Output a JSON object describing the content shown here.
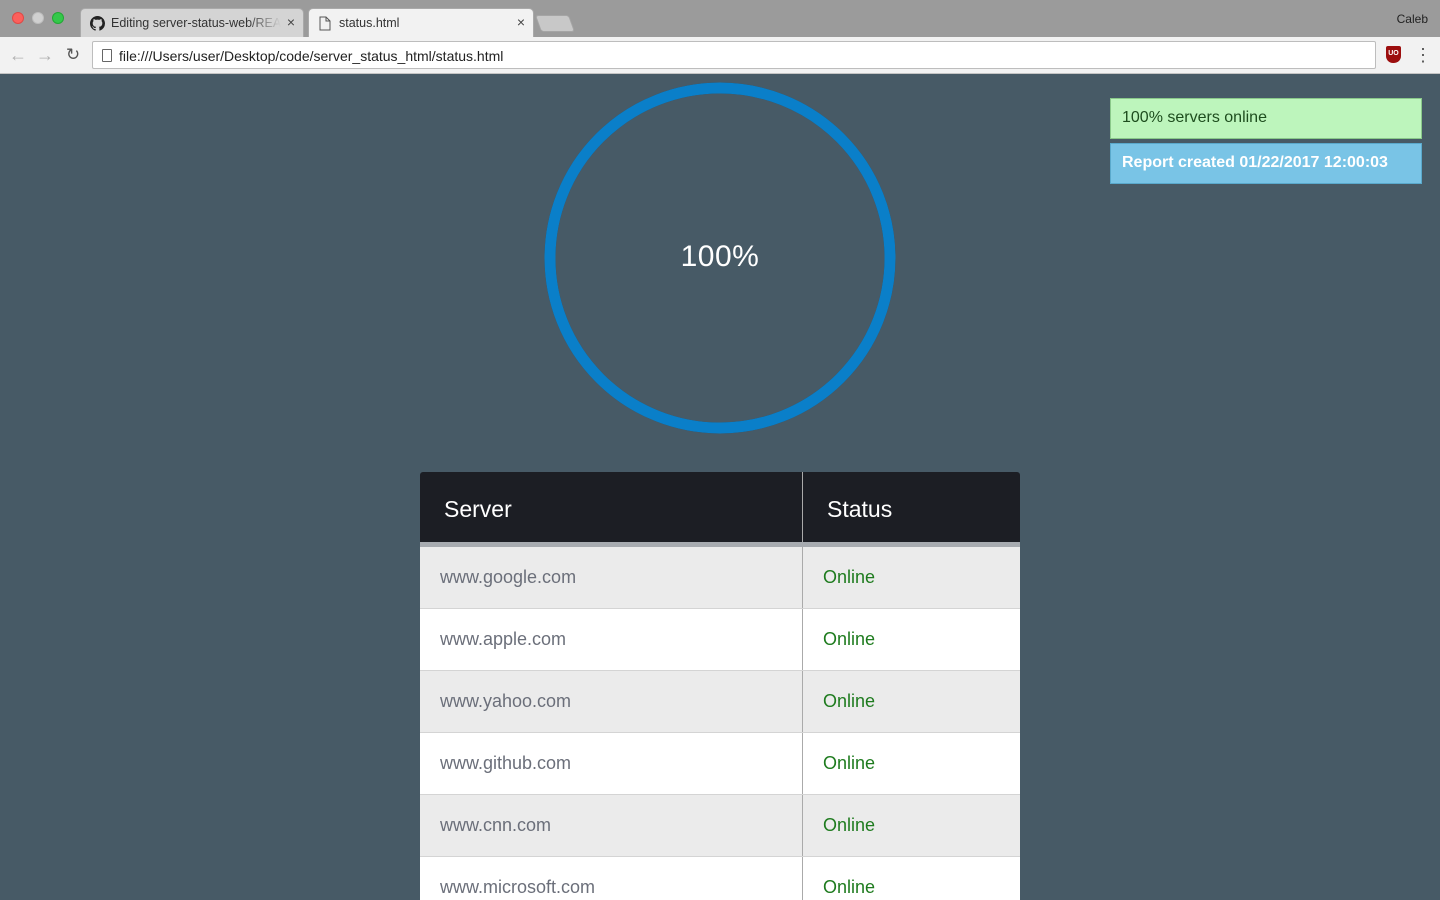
{
  "browser": {
    "profile_name": "Caleb",
    "tabs": [
      {
        "title": "Editing server-status-web/README",
        "icon": "github-icon",
        "close": "×"
      },
      {
        "title": "status.html",
        "icon": "page-icon",
        "close": "×"
      }
    ],
    "url": "file:///Users/user/Desktop/code/server_status_html/status.html",
    "extension_badge": "UO"
  },
  "page": {
    "gauge": {
      "percent_label": "100%",
      "percent": 100,
      "color": "#0a7fc9"
    },
    "notices": {
      "online_summary": "100% servers online",
      "report_created": "Report created 01/22/2017 12:00:03"
    },
    "table": {
      "headers": {
        "server": "Server",
        "status": "Status"
      },
      "rows": [
        {
          "server": "www.google.com",
          "status": "Online"
        },
        {
          "server": "www.apple.com",
          "status": "Online"
        },
        {
          "server": "www.yahoo.com",
          "status": "Online"
        },
        {
          "server": "www.github.com",
          "status": "Online"
        },
        {
          "server": "www.cnn.com",
          "status": "Online"
        },
        {
          "server": "www.microsoft.com",
          "status": "Online"
        }
      ]
    }
  }
}
